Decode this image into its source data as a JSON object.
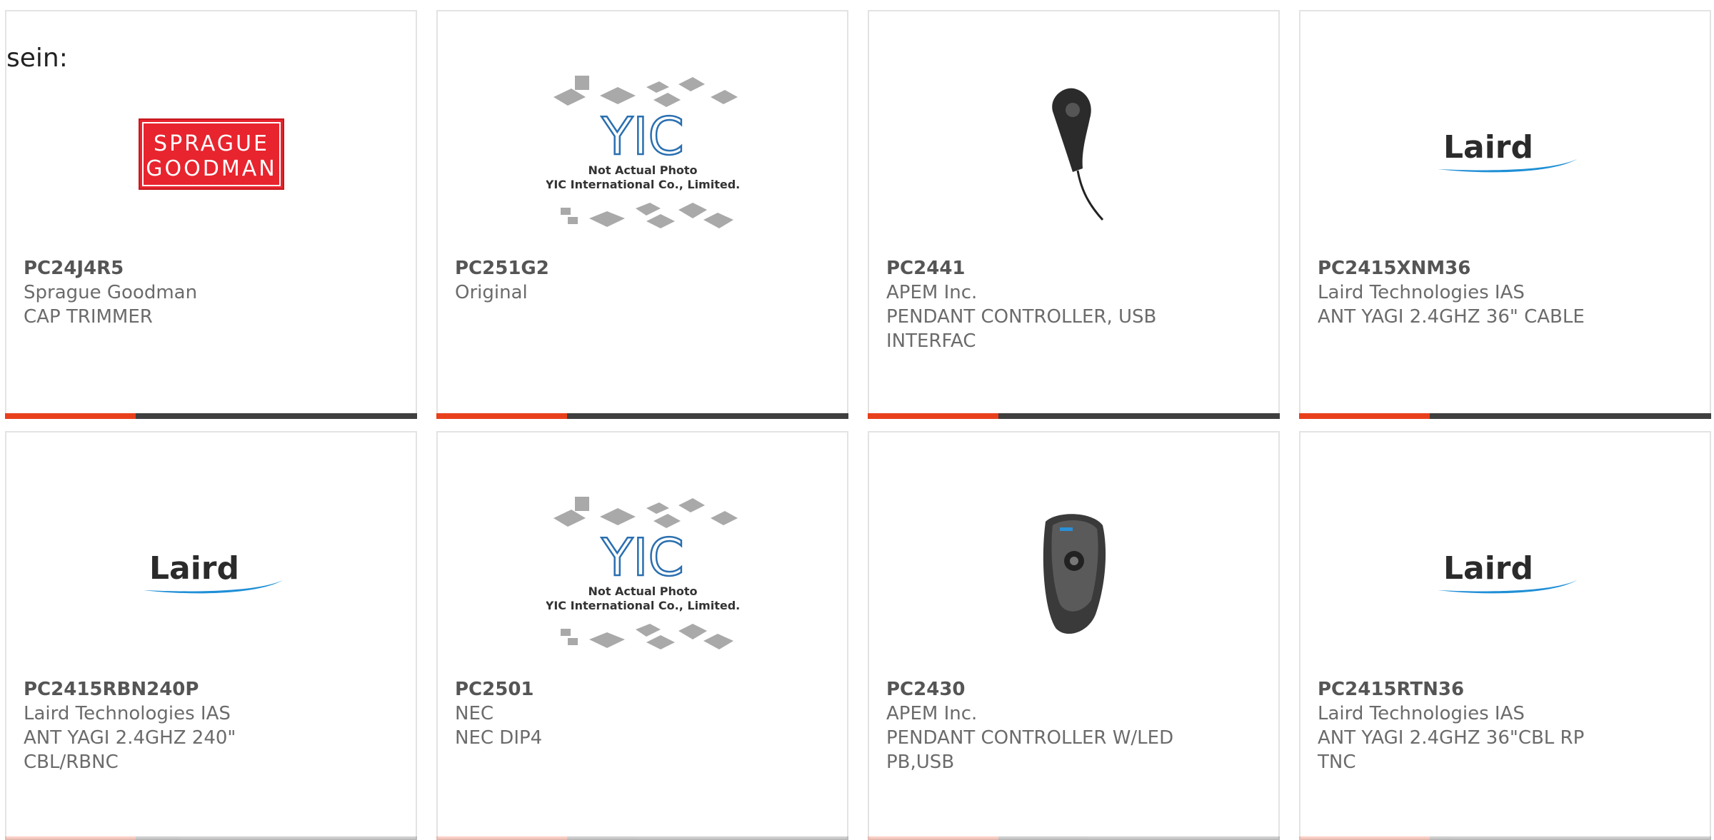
{
  "lead_text": "sein:",
  "brand_colors": {
    "accent": "#e8401c",
    "bar": "#3f3f3f",
    "sprague_red": "#e8242e",
    "laird_blue": "#1f8fd6",
    "yic_blue": "#2a6fb0"
  },
  "logos": {
    "sprague": [
      "SPRAGUE",
      "GOODMAN"
    ],
    "laird": "Laird",
    "yic": {
      "mark": "YIC",
      "line1": "Not Actual Photo",
      "line2": "YIC International Co., Limited."
    }
  },
  "products": [
    {
      "part": "PC24J4R5",
      "maker": "Sprague Goodman",
      "desc": "CAP TRIMMER",
      "desc2": "",
      "image": "sprague-goodman-logo"
    },
    {
      "part": "PC251G2",
      "maker": "Original",
      "desc": "",
      "desc2": "",
      "image": "yic-not-actual-photo"
    },
    {
      "part": "PC2441",
      "maker": "APEM Inc.",
      "desc": "PENDANT CONTROLLER, USB",
      "desc2": "INTERFAC",
      "image": "pendant-controller-photo"
    },
    {
      "part": "PC2415XNM36",
      "maker": "Laird Technologies IAS",
      "desc": "ANT YAGI 2.4GHZ 36\" CABLE",
      "desc2": "",
      "image": "laird-logo"
    },
    {
      "part": "PC2415RBN240P",
      "maker": "Laird Technologies IAS",
      "desc": "ANT YAGI 2.4GHZ 240\"",
      "desc2": "CBL/RBNC",
      "image": "laird-logo"
    },
    {
      "part": "PC2501",
      "maker": "NEC",
      "desc": "NEC DIP4",
      "desc2": "",
      "image": "yic-not-actual-photo"
    },
    {
      "part": "PC2430",
      "maker": "APEM Inc.",
      "desc": "PENDANT CONTROLLER W/LED",
      "desc2": "PB,USB",
      "image": "pendant-controller-led-photo"
    },
    {
      "part": "PC2415RTN36",
      "maker": "Laird Technologies IAS",
      "desc": "ANT YAGI 2.4GHZ 36\"CBL RP",
      "desc2": "TNC",
      "image": "laird-logo"
    }
  ]
}
